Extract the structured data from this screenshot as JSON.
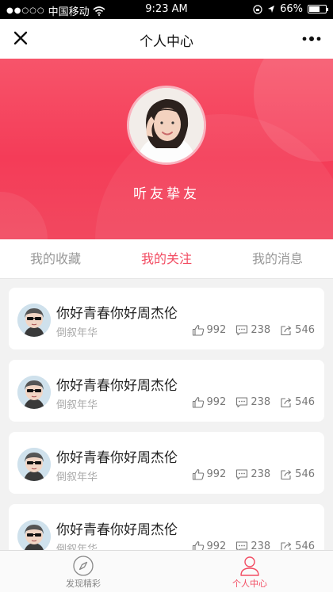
{
  "status_bar": {
    "carrier": "中国移动",
    "time": "9:23 AM",
    "battery": "66%",
    "battery_level": 0.66
  },
  "nav": {
    "title": "个人中心",
    "close_icon": "close-icon",
    "more_icon": "more-icon"
  },
  "profile": {
    "name": "听友挚友",
    "accent_color": "#f24d63"
  },
  "tabs": [
    {
      "label": "我的收藏",
      "active": false
    },
    {
      "label": "我的关注",
      "active": true
    },
    {
      "label": "我的消息",
      "active": false
    }
  ],
  "cards": [
    {
      "title": "你好青春你好周杰伦",
      "author": "倒叙年华",
      "likes": "992",
      "comments": "238",
      "shares": "546"
    },
    {
      "title": "你好青春你好周杰伦",
      "author": "倒叙年华",
      "likes": "992",
      "comments": "238",
      "shares": "546"
    },
    {
      "title": "你好青春你好周杰伦",
      "author": "倒叙年华",
      "likes": "992",
      "comments": "238",
      "shares": "546"
    },
    {
      "title": "你好青春你好周杰伦",
      "author": "倒叙年华",
      "likes": "992",
      "comments": "238",
      "shares": "546"
    }
  ],
  "tabbar": [
    {
      "label": "发现精彩",
      "icon": "compass-icon",
      "active": false
    },
    {
      "label": "个人中心",
      "icon": "user-icon",
      "active": true
    }
  ]
}
